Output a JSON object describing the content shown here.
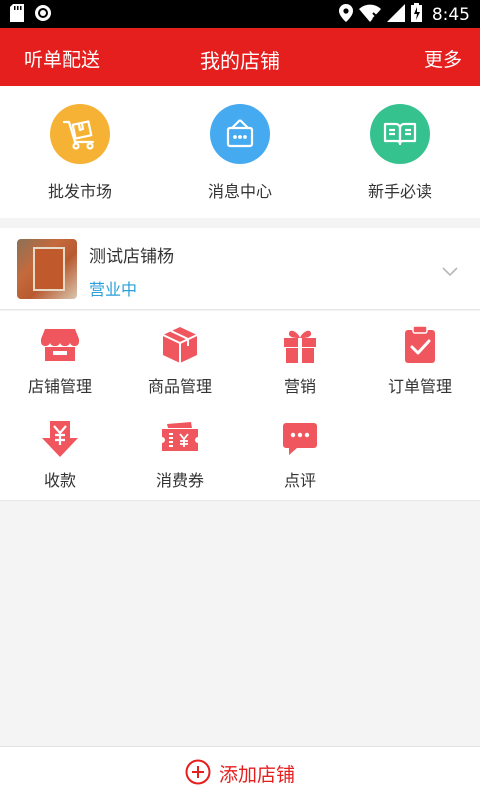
{
  "status_bar": {
    "time": "8:45"
  },
  "app_bar": {
    "left_label": "听单配送",
    "title": "我的店铺",
    "right_label": "更多"
  },
  "shortcuts": [
    {
      "label": "批发市场",
      "icon": "cart-icon",
      "color": "#f5b234"
    },
    {
      "label": "消息中心",
      "icon": "message-box-icon",
      "color": "#45aaf0"
    },
    {
      "label": "新手必读",
      "icon": "book-icon",
      "color": "#35c28e"
    }
  ],
  "store": {
    "name": "测试店铺杨",
    "status": "营业中"
  },
  "functions": [
    {
      "label": "店铺管理",
      "icon": "store-icon"
    },
    {
      "label": "商品管理",
      "icon": "box-icon"
    },
    {
      "label": "营销",
      "icon": "gift-icon"
    },
    {
      "label": "订单管理",
      "icon": "clipboard-check-icon"
    },
    {
      "label": "收款",
      "icon": "yen-arrow-icon"
    },
    {
      "label": "消费券",
      "icon": "coupon-icon"
    },
    {
      "label": "点评",
      "icon": "comment-icon"
    }
  ],
  "bottom": {
    "add_store_label": "添加店铺"
  },
  "colors": {
    "brand_red": "#e51e1e",
    "icon_red": "#f0565e",
    "status_blue": "#2b9fd9"
  }
}
